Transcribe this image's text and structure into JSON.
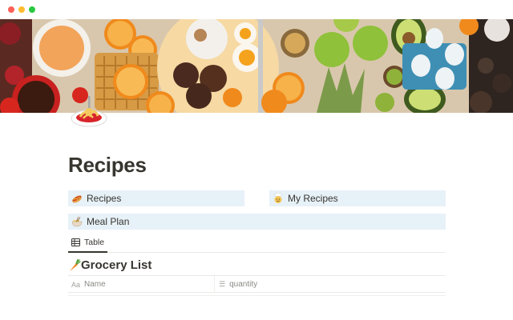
{
  "window": {
    "controls": [
      "close",
      "minimize",
      "zoom"
    ]
  },
  "colors": {
    "accent_link_bg": "#e7f1f8",
    "text": "#37352f",
    "muted": "#8a8985"
  },
  "cover": {
    "description_icon": "breakfast-spread-photo"
  },
  "page": {
    "icon": "spaghetti-icon",
    "title": "Recipes"
  },
  "links": [
    {
      "icon": "hotdog-icon",
      "label": "Recipes"
    },
    {
      "icon": "cook-icon",
      "label": "My Recipes"
    },
    {
      "icon": "ramen-bowl-icon",
      "label": "Meal Plan"
    }
  ],
  "views": {
    "tabs": [
      {
        "icon": "table-icon",
        "label": "Table"
      }
    ]
  },
  "database": {
    "icon": "carrot-icon",
    "title": "Grocery List",
    "columns": [
      {
        "icon": "text-type-icon",
        "icon_text": "Aa",
        "label": "Name"
      },
      {
        "icon": "list-icon",
        "icon_text": "☰",
        "label": "quantity"
      }
    ]
  }
}
